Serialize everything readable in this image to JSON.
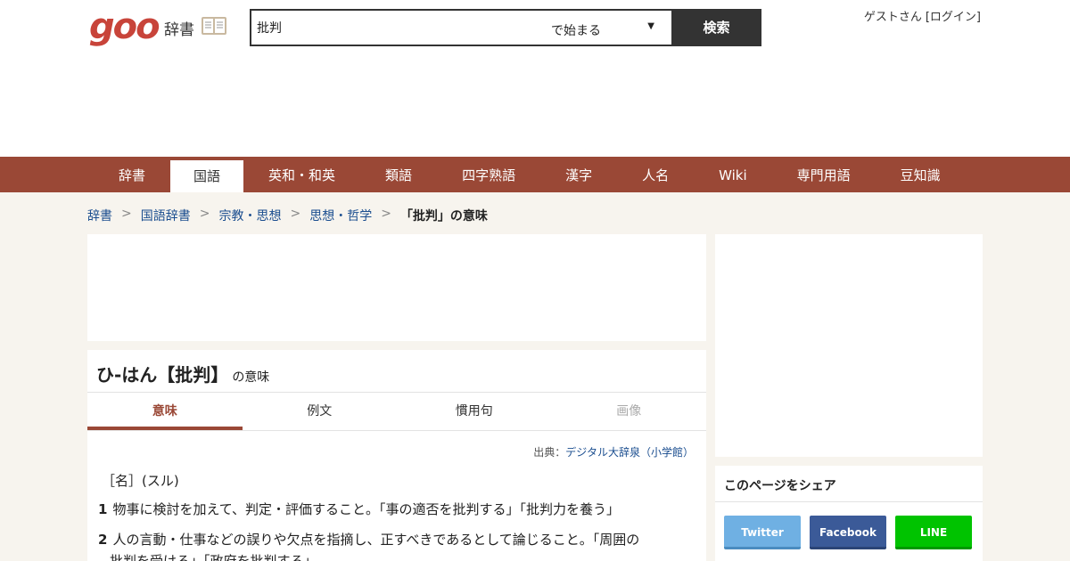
{
  "header": {
    "logo_text": "goo",
    "logo_sub": "辞書",
    "search_value": "批判",
    "search_mode": "で始まる",
    "search_button": "検索",
    "user_name": "ゲストさん",
    "login_link": "[ログイン]"
  },
  "nav": {
    "items": [
      "辞書",
      "国語",
      "英和・和英",
      "類語",
      "四字熟語",
      "漢字",
      "人名",
      "Wiki",
      "専門用語",
      "豆知識"
    ],
    "active_index": 1
  },
  "breadcrumb": {
    "items": [
      "辞書",
      "国語辞書",
      "宗教・思想",
      "思想・哲学"
    ],
    "current": "「批判」の意味",
    "separator": ">"
  },
  "entry": {
    "headword": "ひ‐はん【批判】",
    "headword_suffix": "の意味",
    "tabs": [
      "意味",
      "例文",
      "慣用句",
      "画像"
    ],
    "active_tab": 0,
    "disabled_tab": 3,
    "source_label": "出典：",
    "source_name": "デジタル大辞泉（小学館）",
    "pos": "［名］(スル)",
    "definitions": [
      {
        "num": "1",
        "text": "物事に検討を加えて、判定・評価すること。「事の適否を批判する」「批判力を養う」"
      },
      {
        "num": "2",
        "text_line1": "人の言動・仕事などの誤りや欠点を指摘し、正すべきであるとして論じること。「周囲の",
        "text_line2": "批判を受ける」「政府を批判する」"
      }
    ]
  },
  "share": {
    "title": "このページをシェア",
    "twitter": "Twitter",
    "facebook": "Facebook",
    "line": "LINE"
  },
  "colors": {
    "brand": "#c8443a",
    "nav_bg": "#9a4836",
    "link": "#1a4d8f",
    "page_bg": "#f7f4ee"
  }
}
